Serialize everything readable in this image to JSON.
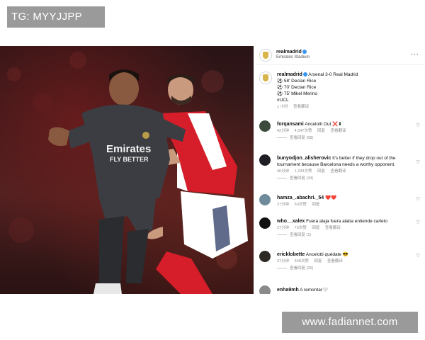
{
  "top_tag": "TG: MYYJJPP",
  "watermark": "www.fadiannet.com",
  "post": {
    "account": "realmadrid",
    "location": "Emirates Stadium",
    "caption_account": "realmadrid",
    "caption_line1": "Arsenal 3-0 Real Madrid",
    "goals": [
      "58' Declan Rice",
      "70' Declan Rice",
      "75' Mikel Merino"
    ],
    "hashtag": "#UCL",
    "caption_time": "1 小时",
    "caption_translate": "查看翻译"
  },
  "comments": [
    {
      "user": "forqansami",
      "text": "Ancelotti Out ❌⬇",
      "meta": [
        "42分钟",
        "4,047次赞",
        "回复",
        "查看翻译"
      ],
      "replies": "查看回复 (58)"
    },
    {
      "user": "bunyodjon_alisherovic",
      "text": "It's better if they drop out of the tournament because Barcelona needs a worthy opponent.",
      "meta": [
        "40分钟",
        "1,234次赞",
        "回复",
        "查看翻译"
      ],
      "replies": "查看回复 (34)"
    },
    {
      "user": "hamza_.abachri._54",
      "text": "❤️❤️",
      "meta": [
        "27分钟",
        "60次赞",
        "回复"
      ],
      "replies": ""
    },
    {
      "user": "who__xalex",
      "text": "Fuera alaja fuera alaba entiende carleto",
      "meta": [
        "27分钟",
        "73次赞",
        "回复",
        "查看翻译"
      ],
      "replies": "查看回复 (1)"
    },
    {
      "user": "ericklobette",
      "text": "Ancelotti quédate 😎",
      "meta": [
        "37分钟",
        "548次赞",
        "回复",
        "查看翻译"
      ],
      "replies": "查看回复 (25)"
    },
    {
      "user": "enha9mh",
      "text": "A remontar🤍",
      "meta": [],
      "replies": ""
    }
  ],
  "photo": {
    "shirt_sponsor_line1": "Emirates",
    "shirt_sponsor_line2": "FLY BETTER"
  },
  "colors": {
    "tag_bg": "#9a9a9a",
    "arsenal_red": "#d61d2a",
    "madrid_kit": "#3b3d42"
  }
}
